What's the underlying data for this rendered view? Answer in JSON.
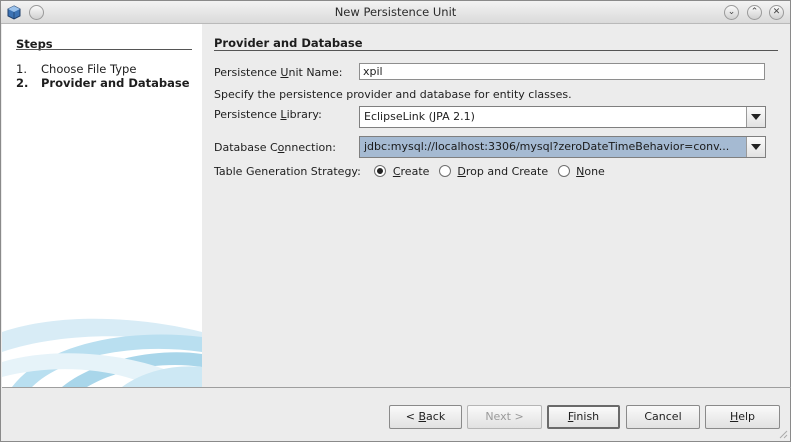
{
  "window": {
    "title": "New Persistence Unit",
    "icons": [
      "app-cube-icon",
      "menu-circle-icon",
      "minimize-icon",
      "maximize-icon",
      "close-icon"
    ]
  },
  "steps": {
    "title": "Steps",
    "items": [
      {
        "num": "1.",
        "label": "Choose File Type"
      },
      {
        "num": "2.",
        "label": "Provider and Database"
      }
    ]
  },
  "panel": {
    "title": "Provider and Database",
    "unit_name": {
      "label_pre": "Persistence ",
      "label_mn": "U",
      "label_post": "nit Name:",
      "value": "xpil"
    },
    "description": "Specify the persistence provider and database for entity classes.",
    "library": {
      "label_pre": "Persistence ",
      "label_mn": "L",
      "label_post": "ibrary:",
      "value": "EclipseLink (JPA 2.1)"
    },
    "connection": {
      "label_pre": "Database C",
      "label_mn": "o",
      "label_post": "nnection:",
      "value": "jdbc:mysql://localhost:3306/mysql?zeroDateTimeBehavior=conv..."
    },
    "strategy": {
      "label": "Table Generation Strategy:",
      "options": [
        {
          "mn": "C",
          "rest": "reate",
          "selected": true
        },
        {
          "mn": "D",
          "rest": "rop and Create",
          "selected": false
        },
        {
          "mn": "N",
          "rest": "one",
          "selected": false
        }
      ]
    }
  },
  "buttons": {
    "back": {
      "pre": "< ",
      "mn": "B",
      "rest": "ack"
    },
    "next": "Next >",
    "finish": {
      "mn": "F",
      "rest": "inish"
    },
    "cancel": "Cancel",
    "help": {
      "mn": "H",
      "rest": "elp"
    }
  },
  "colors": {
    "selection": "#a5bad2",
    "left_bg": "#ffffff",
    "swoosh": "#a9d6ea"
  }
}
